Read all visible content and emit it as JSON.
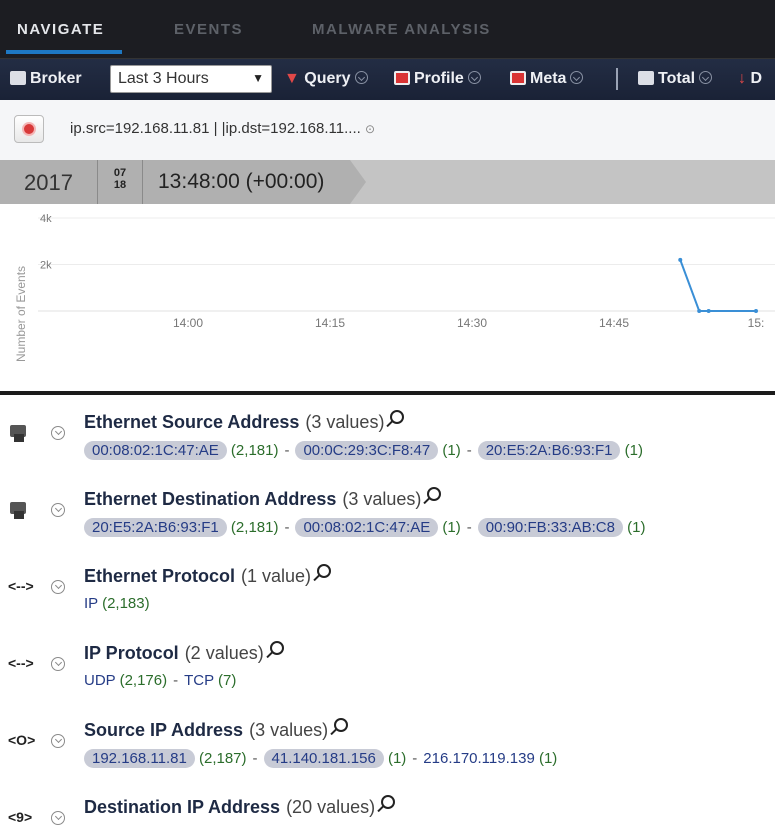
{
  "nav": {
    "tabs": [
      {
        "label": "NAVIGATE",
        "active": true
      },
      {
        "label": "EVENTS",
        "active": false
      },
      {
        "label": "MALWARE ANALYSIS",
        "active": false
      }
    ]
  },
  "toolbar": {
    "broker": "Broker",
    "time_range": "Last 3 Hours",
    "query": "Query",
    "profile": "Profile",
    "meta": "Meta",
    "total": "Total",
    "cut_label": "D"
  },
  "query_bar": {
    "text": "ip.src=192.168.11.81 | |ip.dst=192.168.11.... "
  },
  "timeline": {
    "year": "2017",
    "month": "07",
    "day": "18",
    "time": "13:48:00 (+00:00)"
  },
  "chart_data": {
    "type": "line",
    "ylabel": "Number of Events",
    "yticks": [
      "4k",
      "2k"
    ],
    "xticks": [
      "14:00",
      "14:15",
      "14:30",
      "14:45",
      "15:"
    ],
    "points": [
      {
        "x": "14:52",
        "y": 2200
      },
      {
        "x": "14:54",
        "y": 0
      },
      {
        "x": "14:55",
        "y": 0
      },
      {
        "x": "15:00",
        "y": 0
      }
    ],
    "colors": {
      "line": "#3a8fd6"
    }
  },
  "meta_items": [
    {
      "icon": "shield-icon",
      "title": "Ethernet Source Address",
      "count": "(3 values)",
      "values": [
        {
          "v": "00:08:02:1C:47:AE",
          "c": "(2,181)",
          "pill": true
        },
        {
          "v": "00:0C:29:3C:F8:47",
          "c": "(1)",
          "pill": true
        },
        {
          "v": "20:E5:2A:B6:93:F1",
          "c": "(1)",
          "pill": true
        }
      ]
    },
    {
      "icon": "shield-icon",
      "title": "Ethernet Destination Address",
      "count": "(3 values)",
      "values": [
        {
          "v": "20:E5:2A:B6:93:F1",
          "c": "(2,181)",
          "pill": true
        },
        {
          "v": "00:08:02:1C:47:AE",
          "c": "(1)",
          "pill": true
        },
        {
          "v": "00:90:FB:33:AB:C8",
          "c": "(1)",
          "pill": true
        }
      ]
    },
    {
      "icon": "<-->",
      "title": "Ethernet Protocol",
      "count": "(1 value)",
      "values": [
        {
          "v": "IP",
          "c": "(2,183)",
          "pill": false
        }
      ]
    },
    {
      "icon": "<-->",
      "title": "IP Protocol",
      "count": "(2 values)",
      "values": [
        {
          "v": "UDP",
          "c": "(2,176)",
          "pill": false
        },
        {
          "v": "TCP",
          "c": "(7)",
          "pill": false
        }
      ]
    },
    {
      "icon": "<O>",
      "title": "Source IP Address",
      "count": "(3 values)",
      "values": [
        {
          "v": "192.168.11.81",
          "c": "(2,187)",
          "pill": true
        },
        {
          "v": "41.140.181.156",
          "c": "(1)",
          "pill": true
        },
        {
          "v": "216.170.119.139",
          "c": "(1)",
          "pill": false
        }
      ]
    },
    {
      "icon": "<9>",
      "title": "Destination IP Address",
      "count": "(20 values)",
      "values": []
    }
  ]
}
